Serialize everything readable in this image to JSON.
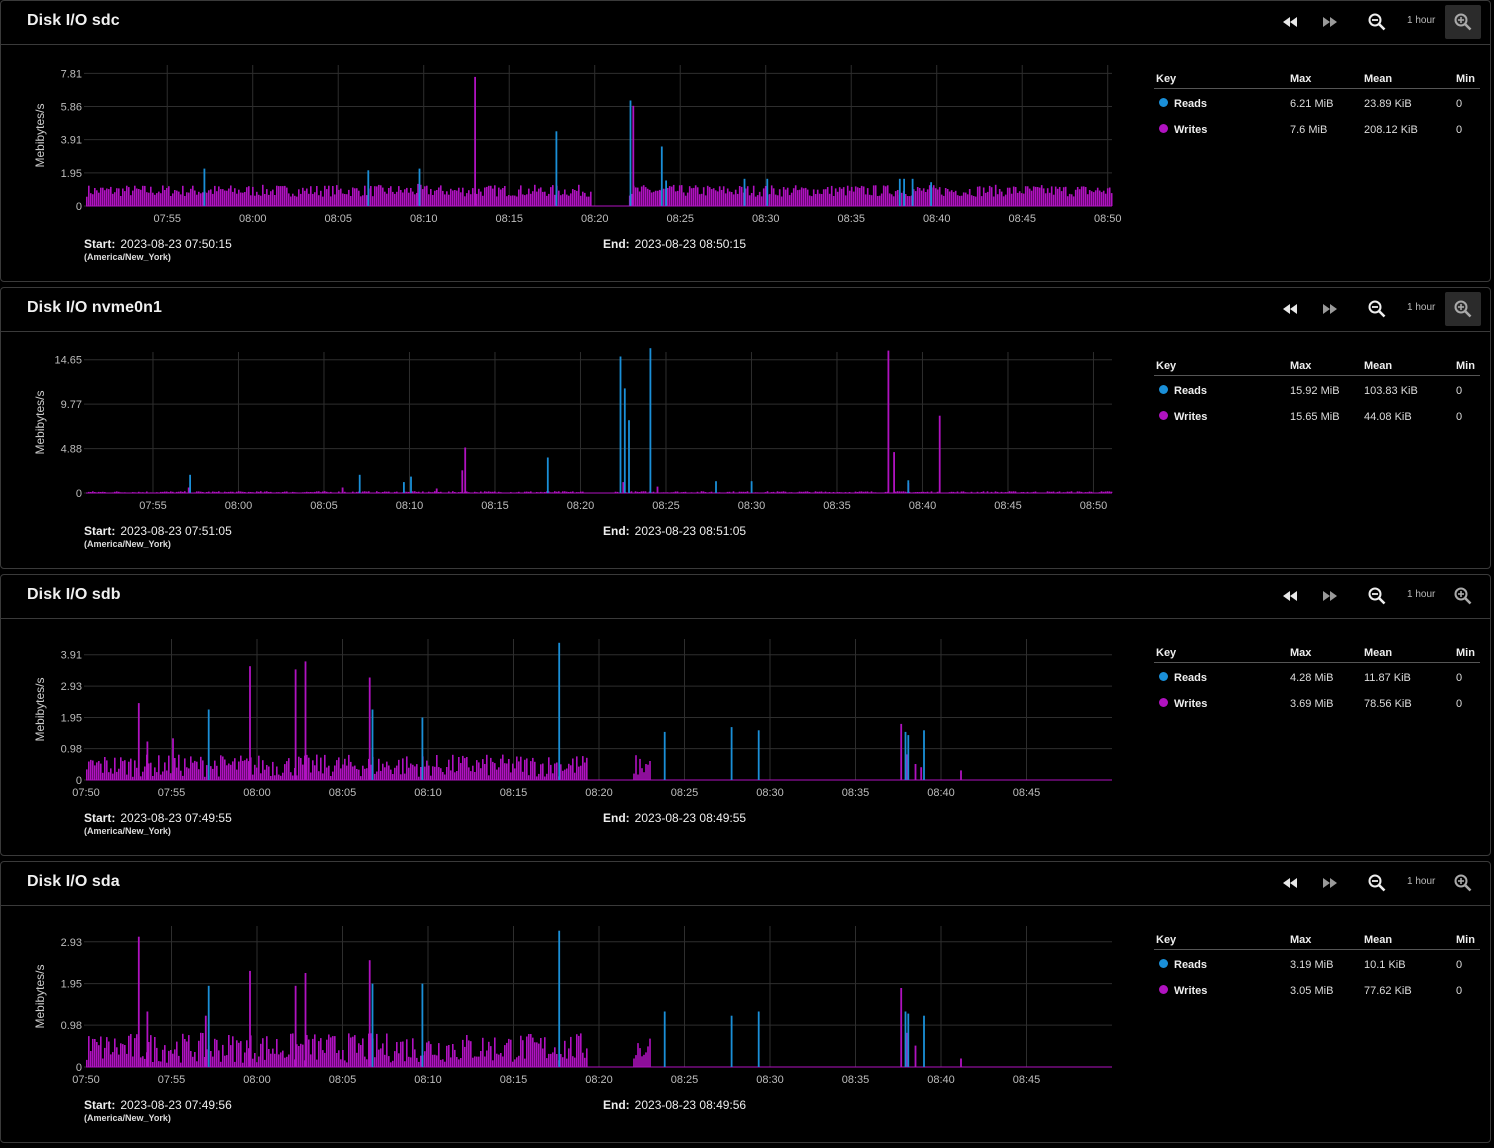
{
  "colors": {
    "reads": "#1a8fd8",
    "writes": "#b012c0",
    "grid": "#2e2e2e",
    "background": "#000000"
  },
  "toolbar": {
    "zoom_level": "1 hour",
    "icons": [
      "rewind-icon",
      "fast-forward-icon",
      "zoom-out-icon",
      "zoom-in-icon"
    ]
  },
  "legend_headers": {
    "key": "Key",
    "max": "Max",
    "mean": "Mean",
    "min": "Min"
  },
  "tz_label": "(America/New_York)",
  "start_label": "Start:",
  "end_label": "End:",
  "panels": [
    {
      "title": "Disk I/O sdc",
      "start": "2023-08-23 07:50:15",
      "end": "2023-08-23 08:50:15",
      "legend": [
        {
          "name": "Reads",
          "max": "6.21 MiB",
          "mean": "23.89 KiB",
          "min": "0"
        },
        {
          "name": "Writes",
          "max": "7.6 MiB",
          "mean": "208.12 KiB",
          "min": "0"
        }
      ]
    },
    {
      "title": "Disk I/O nvme0n1",
      "start": "2023-08-23 07:51:05",
      "end": "2023-08-23 08:51:05",
      "legend": [
        {
          "name": "Reads",
          "max": "15.92 MiB",
          "mean": "103.83 KiB",
          "min": "0"
        },
        {
          "name": "Writes",
          "max": "15.65 MiB",
          "mean": "44.08 KiB",
          "min": "0"
        }
      ]
    },
    {
      "title": "Disk I/O sdb",
      "start": "2023-08-23 07:49:55",
      "end": "2023-08-23 08:49:55",
      "legend": [
        {
          "name": "Reads",
          "max": "4.28 MiB",
          "mean": "11.87 KiB",
          "min": "0"
        },
        {
          "name": "Writes",
          "max": "3.69 MiB",
          "mean": "78.56 KiB",
          "min": "0"
        }
      ]
    },
    {
      "title": "Disk I/O sda",
      "start": "2023-08-23 07:49:56",
      "end": "2023-08-23 08:49:56",
      "legend": [
        {
          "name": "Reads",
          "max": "3.19 MiB",
          "mean": "10.1 KiB",
          "min": "0"
        },
        {
          "name": "Writes",
          "max": "3.05 MiB",
          "mean": "77.62 KiB",
          "min": "0"
        }
      ]
    }
  ],
  "chart_data": [
    {
      "type": "bar",
      "title": "Disk I/O sdc",
      "ylabel": "Mebibytes/s",
      "ylim": [
        0,
        8.3
      ],
      "yticks": [
        "0",
        "1.95",
        "3.91",
        "5.86",
        "7.81"
      ],
      "ytick_values": [
        0,
        1.95,
        3.91,
        5.86,
        7.81
      ],
      "xlim": [
        "07:50:15",
        "08:50:15"
      ],
      "xticks": [
        "07:55",
        "08:00",
        "08:05",
        "08:10",
        "08:15",
        "08:20",
        "08:25",
        "08:30",
        "08:35",
        "08:40",
        "08:45",
        "08:50"
      ],
      "gaps": [
        [
          "08:19:45",
          "08:22:00"
        ]
      ],
      "series": [
        {
          "name": "Writes",
          "baseline": 0.9,
          "baseline_jitter": 0.35,
          "baseline_ranges": [
            [
              "07:50:15",
              "08:19:45"
            ],
            [
              "08:22:00",
              "08:50:15"
            ]
          ],
          "spikes": [
            [
              "08:13:00",
              7.6
            ],
            [
              "08:22:15",
              5.9
            ],
            [
              "08:09:40",
              1.3
            ],
            [
              "08:23:50",
              0.9
            ]
          ]
        },
        {
          "name": "Reads",
          "spikes": [
            [
              "07:57:10",
              2.2
            ],
            [
              "08:06:45",
              2.1
            ],
            [
              "08:09:45",
              2.2
            ],
            [
              "08:17:45",
              4.4
            ],
            [
              "08:22:05",
              6.21
            ],
            [
              "08:23:55",
              3.5
            ],
            [
              "08:24:10",
              1.5
            ],
            [
              "08:28:45",
              1.6
            ],
            [
              "08:30:05",
              1.6
            ],
            [
              "08:37:50",
              1.6
            ],
            [
              "08:38:05",
              1.6
            ],
            [
              "08:38:35",
              1.6
            ],
            [
              "08:39:40",
              1.4
            ]
          ]
        }
      ]
    },
    {
      "type": "bar",
      "title": "Disk I/O nvme0n1",
      "ylabel": "Mebibytes/s",
      "ylim": [
        0,
        15.5
      ],
      "yticks": [
        "0",
        "4.88",
        "9.77",
        "14.65"
      ],
      "ytick_values": [
        0,
        4.88,
        9.77,
        14.65
      ],
      "xlim": [
        "07:51:05",
        "08:51:05"
      ],
      "xticks": [
        "07:55",
        "08:00",
        "08:05",
        "08:10",
        "08:15",
        "08:20",
        "08:25",
        "08:30",
        "08:35",
        "08:40",
        "08:45",
        "08:50"
      ],
      "gaps": [
        [
          "08:20:10",
          "08:22:00"
        ]
      ],
      "series": [
        {
          "name": "Writes",
          "baseline": 0.1,
          "baseline_jitter": 0.1,
          "baseline_ranges": [
            [
              "07:51:05",
              "08:20:10"
            ],
            [
              "08:22:00",
              "08:51:05"
            ]
          ],
          "spikes": [
            [
              "08:13:15",
              5.0
            ],
            [
              "08:13:05",
              2.5
            ],
            [
              "08:38:00",
              15.65
            ],
            [
              "08:38:20",
              4.5
            ],
            [
              "08:41:00",
              8.5
            ],
            [
              "07:57:05",
              0.6
            ],
            [
              "08:06:05",
              0.6
            ],
            [
              "08:11:35",
              0.5
            ],
            [
              "08:22:30",
              1.2
            ],
            [
              "08:24:30",
              0.7
            ],
            [
              "08:39:10",
              1.1
            ]
          ]
        },
        {
          "name": "Reads",
          "spikes": [
            [
              "07:57:10",
              2.0
            ],
            [
              "08:07:05",
              2.0
            ],
            [
              "08:10:05",
              1.8
            ],
            [
              "08:09:40",
              1.2
            ],
            [
              "08:18:05",
              3.9
            ],
            [
              "08:22:20",
              15.0
            ],
            [
              "08:22:35",
              11.5
            ],
            [
              "08:22:50",
              8.0
            ],
            [
              "08:24:05",
              15.92
            ],
            [
              "08:27:55",
              1.3
            ],
            [
              "08:30:00",
              1.3
            ],
            [
              "08:39:10",
              1.4
            ]
          ]
        }
      ]
    },
    {
      "type": "bar",
      "title": "Disk I/O sdb",
      "ylabel": "Mebibytes/s",
      "ylim": [
        0,
        4.4
      ],
      "yticks": [
        "0",
        "0.98",
        "1.95",
        "2.93",
        "3.91"
      ],
      "ytick_values": [
        0,
        0.98,
        1.95,
        2.93,
        3.91
      ],
      "xlim": [
        "07:50:00",
        "08:50:00"
      ],
      "xticks": [
        "07:50",
        "07:55",
        "08:00",
        "08:05",
        "08:10",
        "08:15",
        "08:20",
        "08:25",
        "08:30",
        "08:35",
        "08:40",
        "08:45"
      ],
      "gaps": [
        [
          "08:19:15",
          "08:22:00"
        ]
      ],
      "series": [
        {
          "name": "Writes",
          "baseline": 0.45,
          "baseline_jitter": 0.35,
          "baseline_ranges": [
            [
              "07:50:00",
              "08:19:15"
            ],
            [
              "08:22:00",
              "08:23:00"
            ]
          ],
          "spikes": [
            [
              "07:53:05",
              2.4
            ],
            [
              "07:53:35",
              1.2
            ],
            [
              "07:55:05",
              1.3
            ],
            [
              "07:59:35",
              3.55
            ],
            [
              "08:02:15",
              3.45
            ],
            [
              "08:02:50",
              3.7
            ],
            [
              "08:06:35",
              3.2
            ],
            [
              "08:37:40",
              1.75
            ],
            [
              "08:38:00",
              0.8
            ],
            [
              "08:38:30",
              0.5
            ],
            [
              "08:38:50",
              0.4
            ],
            [
              "08:41:10",
              0.3
            ]
          ]
        },
        {
          "name": "Reads",
          "spikes": [
            [
              "07:57:10",
              2.2
            ],
            [
              "08:06:45",
              2.2
            ],
            [
              "08:09:40",
              1.95
            ],
            [
              "08:17:40",
              4.28
            ],
            [
              "08:23:50",
              1.5
            ],
            [
              "08:27:45",
              1.65
            ],
            [
              "08:29:20",
              1.55
            ],
            [
              "08:37:55",
              1.5
            ],
            [
              "08:38:05",
              1.4
            ],
            [
              "08:39:00",
              1.55
            ]
          ]
        }
      ]
    },
    {
      "type": "bar",
      "title": "Disk I/O sda",
      "ylabel": "Mebibytes/s",
      "ylim": [
        0,
        3.3
      ],
      "yticks": [
        "0",
        "0.98",
        "1.95",
        "2.93"
      ],
      "ytick_values": [
        0,
        0.98,
        1.95,
        2.93
      ],
      "xlim": [
        "07:50:00",
        "08:50:00"
      ],
      "xticks": [
        "07:50",
        "07:55",
        "08:00",
        "08:05",
        "08:10",
        "08:15",
        "08:20",
        "08:25",
        "08:30",
        "08:35",
        "08:40",
        "08:45"
      ],
      "gaps": [
        [
          "08:19:15",
          "08:22:00"
        ]
      ],
      "series": [
        {
          "name": "Writes",
          "baseline": 0.45,
          "baseline_jitter": 0.35,
          "baseline_ranges": [
            [
              "07:50:00",
              "08:19:15"
            ],
            [
              "08:22:00",
              "08:23:00"
            ]
          ],
          "spikes": [
            [
              "07:53:05",
              3.05
            ],
            [
              "07:53:35",
              1.3
            ],
            [
              "07:57:00",
              1.2
            ],
            [
              "07:59:35",
              2.25
            ],
            [
              "08:02:15",
              1.9
            ],
            [
              "08:02:50",
              2.2
            ],
            [
              "08:06:35",
              2.5
            ],
            [
              "08:37:40",
              1.85
            ],
            [
              "08:38:00",
              0.8
            ],
            [
              "08:38:30",
              0.5
            ],
            [
              "08:41:10",
              0.2
            ]
          ]
        },
        {
          "name": "Reads",
          "spikes": [
            [
              "07:57:10",
              1.9
            ],
            [
              "08:06:45",
              1.95
            ],
            [
              "08:09:40",
              1.95
            ],
            [
              "08:17:40",
              3.19
            ],
            [
              "08:23:50",
              1.3
            ],
            [
              "08:27:45",
              1.2
            ],
            [
              "08:29:20",
              1.3
            ],
            [
              "08:37:55",
              1.3
            ],
            [
              "08:38:05",
              1.25
            ],
            [
              "08:39:00",
              1.2
            ]
          ]
        }
      ]
    }
  ]
}
